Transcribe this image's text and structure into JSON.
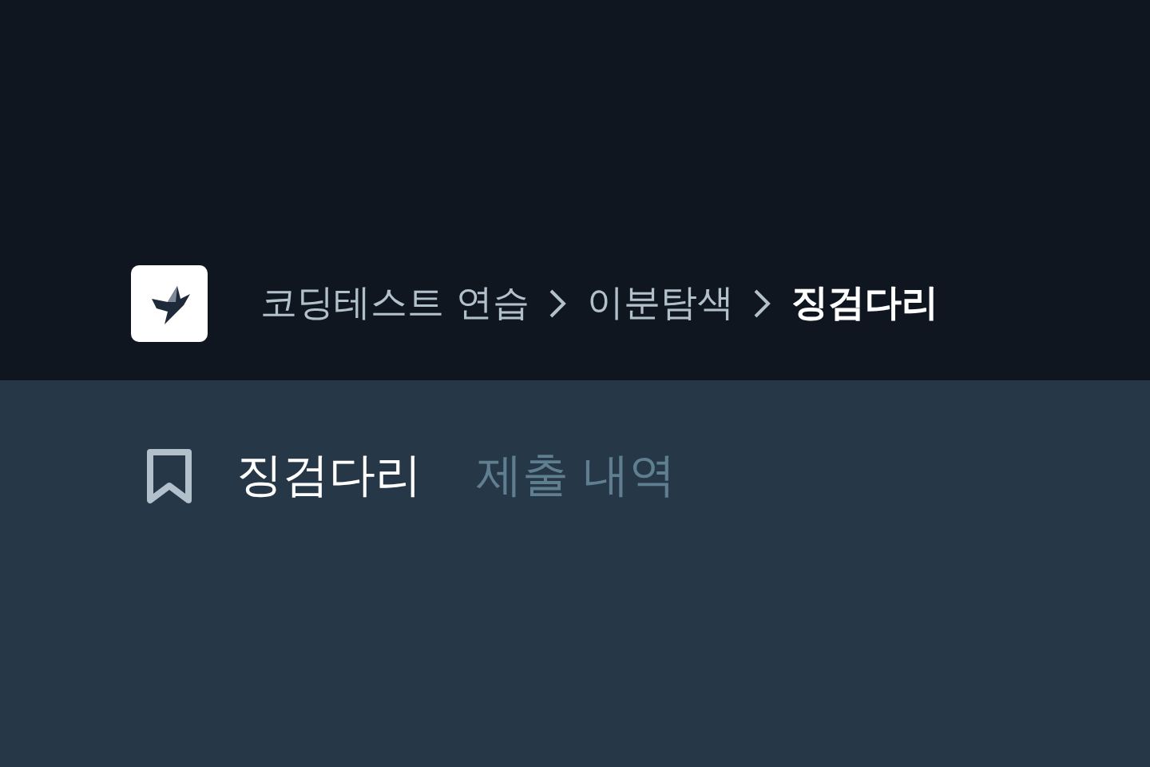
{
  "breadcrumbs": [
    {
      "label": "코딩테스트 연습",
      "selected": false
    },
    {
      "label": "이분탐색",
      "selected": false
    },
    {
      "label": "징검다리",
      "selected": true
    }
  ],
  "tabs": [
    {
      "label": "징검다리",
      "selected": true
    },
    {
      "label": "제출 내역",
      "selected": false
    }
  ]
}
